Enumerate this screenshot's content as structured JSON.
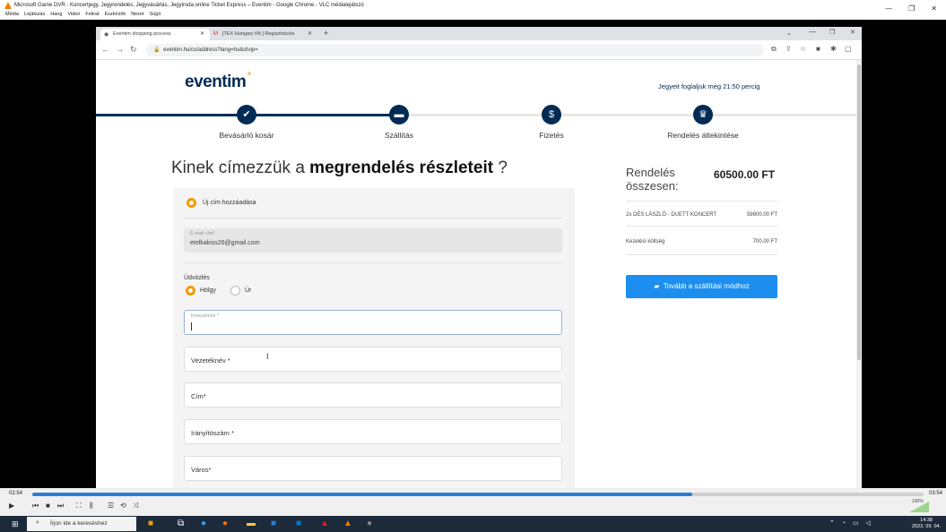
{
  "vlc": {
    "window_title": "Microsoft Game DVR - Koncertjegy, Jegyrendelés, Jegyvásárlás, Jegyiroda online Ticket Express – Eventim - Google Chrome - VLC médialejátszó",
    "menu": [
      "Média",
      "Lejátszás",
      "Hang",
      "Videó",
      "Felirat",
      "Eszközök",
      "Nézet",
      "Súgó"
    ],
    "time_elapsed": "02:54",
    "time_total": "03:54",
    "progress": 0.74,
    "volume_label": "100%"
  },
  "browser": {
    "tabs": [
      {
        "label": "Eventim shopping process",
        "active": true
      },
      {
        "label": "[TEX Hungary Kft.] Regisztrációs",
        "active": false
      }
    ],
    "url": "eventim.hu/co/address?lang=hu&shop="
  },
  "site": {
    "logo": "eventim",
    "timer": "Jegyeit foglaljuk még 21:50 percig",
    "steps": [
      "Bevásárló kosár",
      "Szállítás",
      "Fizetés",
      "Rendelés áttekintése"
    ],
    "heading_pre": "Kinek címezzük a ",
    "heading_bold": "megrendelés részleteit",
    "heading_post": " ?",
    "new_address": "Új cím hozzáadása",
    "email_label": "E-mail cím*",
    "email_value": "etelkakiss26@gmail.com",
    "greeting_label": "Üdvözlés",
    "greeting_options": [
      "Hölgy",
      "Úr"
    ],
    "fields": {
      "first_name": "Keresztnév *",
      "last_name": "Vezetéknév *",
      "address": "Cím*",
      "zip": "Irányítószám *",
      "city": "Város*"
    }
  },
  "summary": {
    "title": "Rendelés összesen:",
    "total": "60500.00 FT",
    "rows": [
      {
        "label": "2x DÉS LÁSZLÓ - DUETT KONCERT",
        "value": "59800.00 FT"
      },
      {
        "label": "Kezelési költség",
        "value": "700.00 FT"
      }
    ],
    "cta": "Tovább a szállítási módhoz"
  },
  "taskbar": {
    "search_placeholder": "Írjon ide a kereséshez",
    "time": "14:38",
    "date": "2023. 09. 04."
  }
}
